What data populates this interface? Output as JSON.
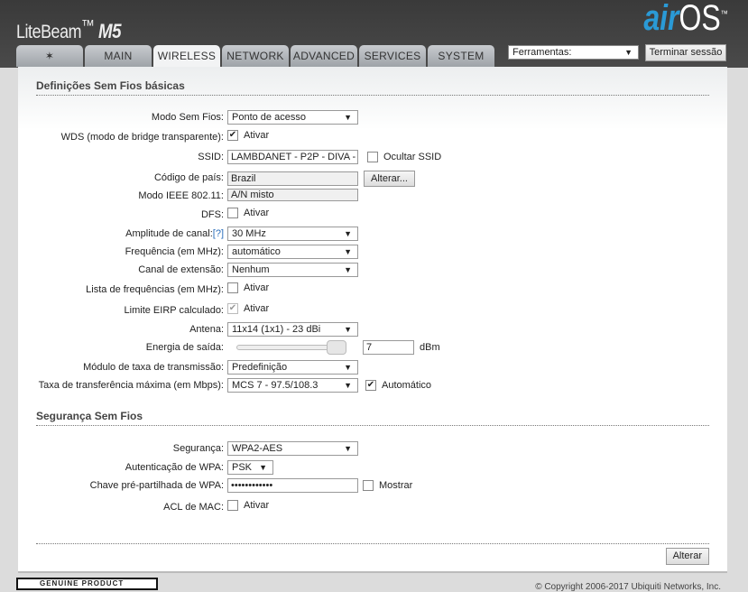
{
  "header": {
    "product": "LiteBeam",
    "model": "M5",
    "os_brand_a": "air",
    "os_brand_b": "OS"
  },
  "tabs": [
    {
      "label": "",
      "icon": "ubiquiti-logo-icon"
    },
    {
      "label": "MAIN"
    },
    {
      "label": "WIRELESS",
      "active": true
    },
    {
      "label": "NETWORK"
    },
    {
      "label": "ADVANCED"
    },
    {
      "label": "SERVICES"
    },
    {
      "label": "SYSTEM"
    }
  ],
  "tools": {
    "label": "Ferramentas:",
    "logout": "Terminar sessão"
  },
  "basic": {
    "title": "Definições Sem Fios básicas",
    "mode": {
      "label": "Modo Sem Fios:",
      "value": "Ponto de acesso"
    },
    "wds": {
      "label": "WDS (modo de bridge transparente):",
      "checked": true,
      "text": "Ativar"
    },
    "ssid": {
      "label": "SSID:",
      "value": "LAMBDANET - P2P - DIVA -",
      "hide": "Ocultar SSID"
    },
    "country": {
      "label": "Código de país:",
      "value": "Brazil",
      "button": "Alterar..."
    },
    "ieee": {
      "label": "Modo IEEE 802.11:",
      "value": "A/N misto"
    },
    "dfs": {
      "label": "DFS:",
      "text": "Ativar"
    },
    "width": {
      "label": "Amplitude de canal:",
      "help": "[?]",
      "value": "30 MHz"
    },
    "freq": {
      "label": "Frequência (em MHz):",
      "value": "automático"
    },
    "ext": {
      "label": "Canal de extensão:",
      "value": "Nenhum"
    },
    "freqlist": {
      "label": "Lista de frequências (em MHz):",
      "text": "Ativar"
    },
    "eirp": {
      "label": "Limite EIRP calculado:",
      "text": "Ativar",
      "checked": true
    },
    "antenna": {
      "label": "Antena:",
      "value": "11x14 (1x1) - 23 dBi"
    },
    "power": {
      "label": "Energia de saída:",
      "value": "7",
      "unit": "dBm",
      "slider_fraction": 1.0
    },
    "ratemod": {
      "label": "Módulo de taxa de transmissão:",
      "value": "Predefinição"
    },
    "maxrate": {
      "label": "Taxa de transferência máxima (em Mbps):",
      "value": "MCS 7 - 97.5/108.3",
      "auto": "Automático",
      "checked": true
    }
  },
  "security": {
    "title": "Segurança Sem Fios",
    "sec": {
      "label": "Segurança:",
      "value": "WPA2-AES"
    },
    "auth": {
      "label": "Autenticação de WPA:",
      "value": "PSK"
    },
    "key": {
      "label": "Chave pré-partilhada de WPA:",
      "value": "••••••••••••",
      "show": "Mostrar"
    },
    "acl": {
      "label": "ACL de MAC:",
      "text": "Ativar"
    }
  },
  "footer": {
    "apply": "Alterar",
    "badge": "GENUINE PRODUCT",
    "copyright": "© Copyright 2006-2017 Ubiquiti Networks, Inc."
  }
}
